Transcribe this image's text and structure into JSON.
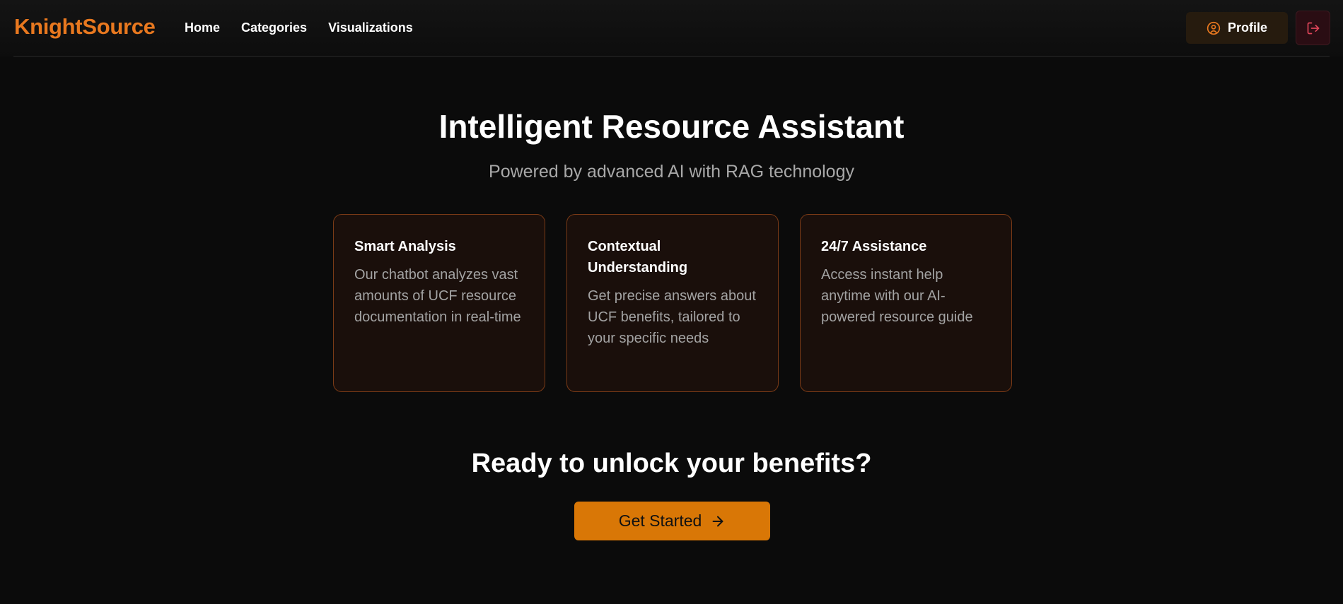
{
  "navbar": {
    "brand": "KnightSource",
    "links": [
      {
        "label": "Home"
      },
      {
        "label": "Categories"
      },
      {
        "label": "Visualizations"
      }
    ],
    "profile_label": "Profile",
    "profile_icon": "user-circle-icon",
    "logout_icon": "logout-icon"
  },
  "hero": {
    "title": "Intelligent Resource Assistant",
    "subtitle": "Powered by advanced AI with RAG technology"
  },
  "features": [
    {
      "title": "Smart Analysis",
      "description": "Our chatbot analyzes vast amounts of UCF resource documentation in real-time"
    },
    {
      "title": "Contextual Understanding",
      "description": "Get precise answers about UCF benefits, tailored to your specific needs"
    },
    {
      "title": "24/7 Assistance",
      "description": "Access instant help anytime with our AI-powered resource guide"
    }
  ],
  "cta": {
    "title": "Ready to unlock your benefits?",
    "button_label": "Get Started",
    "button_icon": "arrow-right-icon"
  },
  "colors": {
    "background": "#0b0b0b",
    "brand": "#e8781f",
    "accent_button": "#d97706",
    "card_border": "#7a3a16",
    "logout_icon": "#e0455a"
  }
}
